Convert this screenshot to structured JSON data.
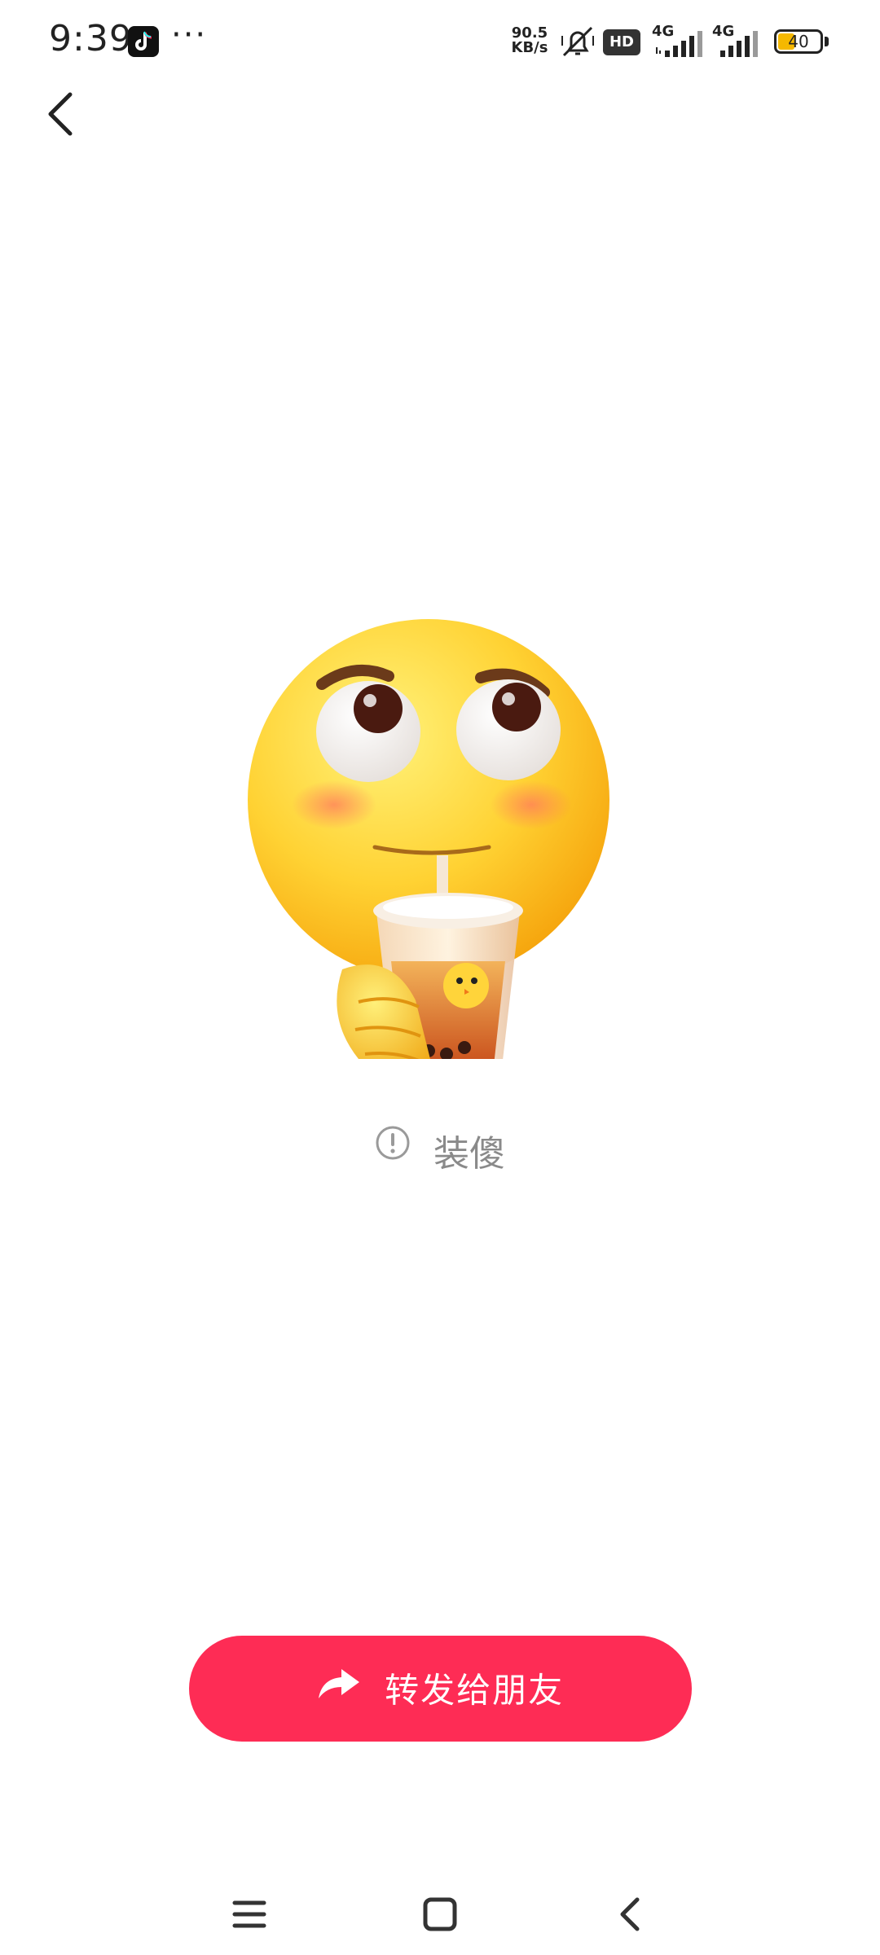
{
  "status_bar": {
    "time": "9:39",
    "more": "···",
    "net_speed_value": "90.5",
    "net_speed_unit": "KB/s",
    "hd_label": "HD",
    "signal1_label": "4G",
    "signal2_label": "4G",
    "battery_level": "40",
    "battery_color": "#f5b800"
  },
  "header": {
    "back_icon": "chevron-left-icon"
  },
  "main": {
    "emoji_name": "smiling-face-drinking-bubble-tea",
    "caption": "装傻",
    "caption_icon": "info-circle-icon"
  },
  "actions": {
    "share_label": "转发给朋友",
    "share_icon": "forward-arrow-icon",
    "accent_color": "#fe2c55"
  },
  "nav_bar": {
    "recent_icon": "menu-lines-icon",
    "home_icon": "square-home-icon",
    "back_icon": "triangle-back-icon"
  }
}
